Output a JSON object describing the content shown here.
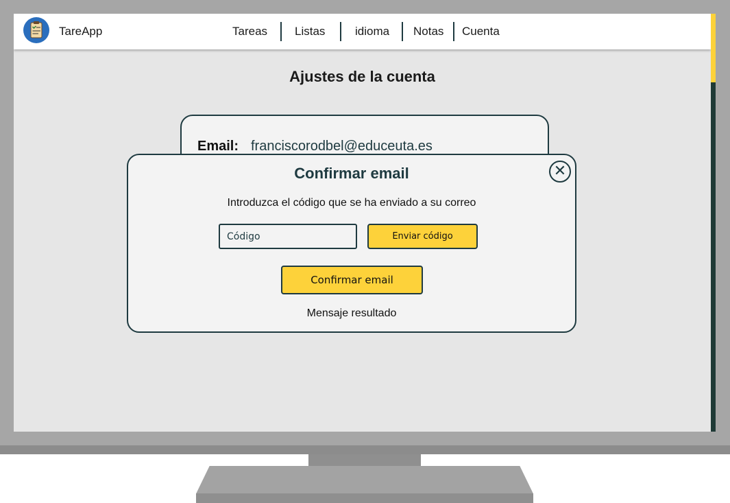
{
  "app": {
    "name": "TareApp",
    "logo_icon": "clipboard-checklist-icon",
    "accent": "#fdd23a",
    "dark": "#1e3a40"
  },
  "nav": {
    "items": [
      {
        "label": "Tareas"
      },
      {
        "label": "Listas"
      },
      {
        "label": "idioma"
      },
      {
        "label": "Notas"
      },
      {
        "label": "Cuenta"
      }
    ]
  },
  "page": {
    "title": "Ajustes de la cuenta"
  },
  "account": {
    "email_label": "Email:",
    "email_value": "franciscorodbel@educeuta.es"
  },
  "modal": {
    "title": "Confirmar email",
    "close_icon": "close-icon",
    "instructions": "Introduzca el código que se ha enviado a su correo",
    "code_placeholder": "Código",
    "send_button": "Enviar código",
    "confirm_button": "Confirmar email",
    "result_message": "Mensaje resultado"
  }
}
